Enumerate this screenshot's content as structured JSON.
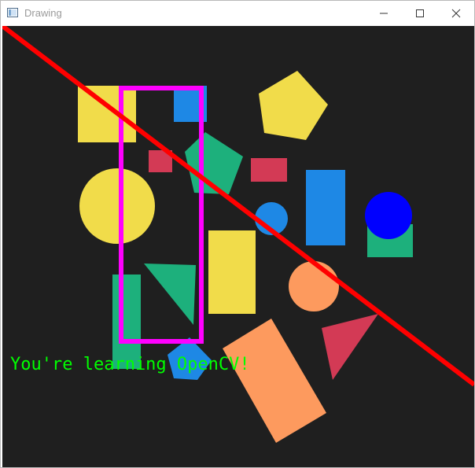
{
  "window": {
    "title": "Drawing",
    "minimize_icon": "minimize-icon",
    "maximize_icon": "maximize-icon",
    "close_icon": "close-icon"
  },
  "canvas": {
    "overlay_text": "You're learning OpenCV!",
    "overlay_text_color": "#00ff00",
    "line_color": "#ff0000",
    "rectangle_color": "#ff00ff",
    "background_color": "#1f1f1f"
  },
  "colors": {
    "yellow": "#f1dc4a",
    "blue": "#1e88e5",
    "green": "#1db07c",
    "red": "#d33a55",
    "orange": "#fd9a5e",
    "pure_blue": "#0000ff"
  }
}
